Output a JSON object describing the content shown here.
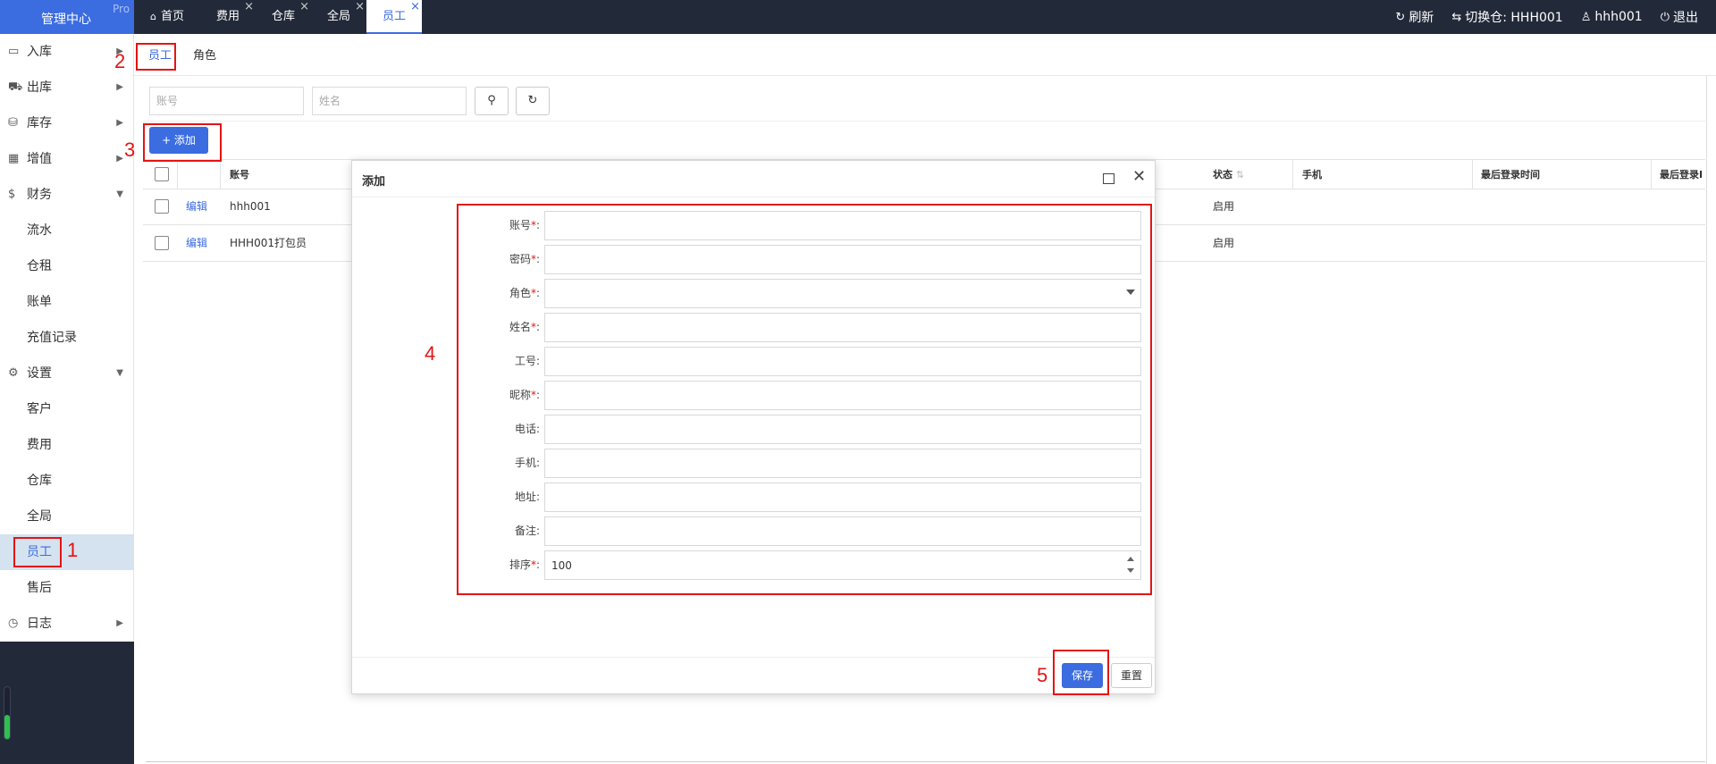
{
  "brand": {
    "title": "管理中心",
    "badge": "Pro"
  },
  "tabs": [
    {
      "label": "首页",
      "closable": false
    },
    {
      "label": "费用",
      "closable": true
    },
    {
      "label": "仓库",
      "closable": true
    },
    {
      "label": "全局",
      "closable": true
    },
    {
      "label": "员工",
      "closable": true,
      "active": true
    }
  ],
  "topright": {
    "refresh": "刷新",
    "switch_warehouse": "切换仓: HHH001",
    "user": "hhh001",
    "logout": "退出"
  },
  "sidebar": {
    "groups": [
      {
        "label": "入库",
        "icon": "inbox-icon"
      },
      {
        "label": "出库",
        "icon": "truck-icon"
      },
      {
        "label": "库存",
        "icon": "boxes-icon"
      },
      {
        "label": "增值",
        "icon": "grid-icon"
      },
      {
        "label": "财务",
        "icon": "dollar-icon"
      },
      {
        "label": "设置",
        "icon": "gears-icon"
      },
      {
        "label": "日志",
        "icon": "clock-icon"
      }
    ],
    "finance_items": [
      "流水",
      "仓租",
      "账单",
      "充值记录"
    ],
    "settings_items": [
      "客户",
      "费用",
      "仓库",
      "全局",
      "员工",
      "售后"
    ]
  },
  "subtabs": [
    "员工",
    "角色"
  ],
  "search": {
    "account_placeholder": "账号",
    "name_placeholder": "姓名"
  },
  "add_button": "+ 添加",
  "table": {
    "headers": {
      "account": "账号",
      "status": "状态",
      "phone": "手机",
      "last_login_time": "最后登录时间",
      "last_login_ip": "最后登录I"
    },
    "rows": [
      {
        "action": "编辑",
        "account": "hhh001",
        "status": "启用"
      },
      {
        "action": "编辑",
        "account": "HHH001打包员",
        "status": "启用"
      }
    ]
  },
  "modal": {
    "title": "添加",
    "fields": [
      {
        "label": "账号",
        "required": true,
        "value": ""
      },
      {
        "label": "密码",
        "required": true,
        "value": ""
      },
      {
        "label": "角色",
        "required": true,
        "value": ""
      },
      {
        "label": "姓名",
        "required": true,
        "value": ""
      },
      {
        "label": "工号",
        "required": false,
        "value": ""
      },
      {
        "label": "昵称",
        "required": true,
        "value": ""
      },
      {
        "label": "电话",
        "required": false,
        "value": ""
      },
      {
        "label": "手机",
        "required": false,
        "value": ""
      },
      {
        "label": "地址",
        "required": false,
        "value": ""
      },
      {
        "label": "备注",
        "required": false,
        "value": ""
      },
      {
        "label": "排序",
        "required": true,
        "value": "100"
      }
    ],
    "save": "保存",
    "reset": "重置"
  },
  "annotations": [
    "1",
    "2",
    "3",
    "4",
    "5"
  ],
  "colors": {
    "accent": "#3b6ce0",
    "topbar": "#222a3a",
    "annotation": "#e41414"
  }
}
